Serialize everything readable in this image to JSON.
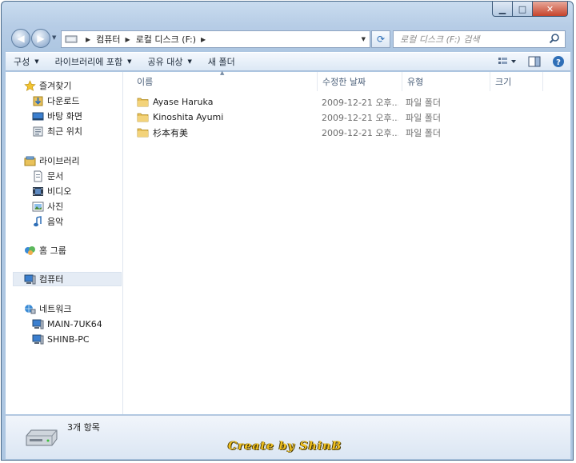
{
  "window": {
    "caption": {
      "minimize": "▁",
      "maximize": "□",
      "close": "✕"
    }
  },
  "address_bar": {
    "segments": [
      "컴퓨터",
      "로컬 디스크 (F:)"
    ],
    "search_placeholder": "로컬 디스크 (F:) 검색"
  },
  "toolbar": {
    "items": [
      {
        "label": "구성",
        "has_dropdown": true
      },
      {
        "label": "라이브러리에 포함",
        "has_dropdown": true
      },
      {
        "label": "공유 대상",
        "has_dropdown": true
      },
      {
        "label": "새 폴더",
        "has_dropdown": false
      }
    ],
    "icons": [
      "view-options-icon",
      "preview-pane-icon",
      "help-icon"
    ]
  },
  "nav_pane": {
    "favorites": {
      "label": "즐겨찾기",
      "items": [
        "다운로드",
        "바탕 화면",
        "최근 위치"
      ]
    },
    "libraries": {
      "label": "라이브러리",
      "items": [
        "문서",
        "비디오",
        "사진",
        "음악"
      ]
    },
    "homegroup": {
      "label": "홈 그룹"
    },
    "computer": {
      "label": "컴퓨터",
      "selected": true
    },
    "network": {
      "label": "네트워크",
      "items": [
        "MAIN-7UK64",
        "SHINB-PC"
      ]
    }
  },
  "file_list": {
    "columns": [
      "이름",
      "수정한 날짜",
      "유형",
      "크기"
    ],
    "rows": [
      {
        "name": "Ayase Haruka",
        "modified": "2009-12-21 오후...",
        "type": "파일 폴더",
        "size": ""
      },
      {
        "name": "Kinoshita Ayumi",
        "modified": "2009-12-21 오후...",
        "type": "파일 폴더",
        "size": ""
      },
      {
        "name": "杉本有美",
        "modified": "2009-12-21 오후...",
        "type": "파일 폴더",
        "size": ""
      }
    ]
  },
  "details_pane": {
    "count": "3개 항목"
  },
  "watermark": "Create by ShinB",
  "colors": {
    "accent": "#2f6fb7",
    "folder": "#e8c15a",
    "title_bar": "#b7cde6"
  }
}
